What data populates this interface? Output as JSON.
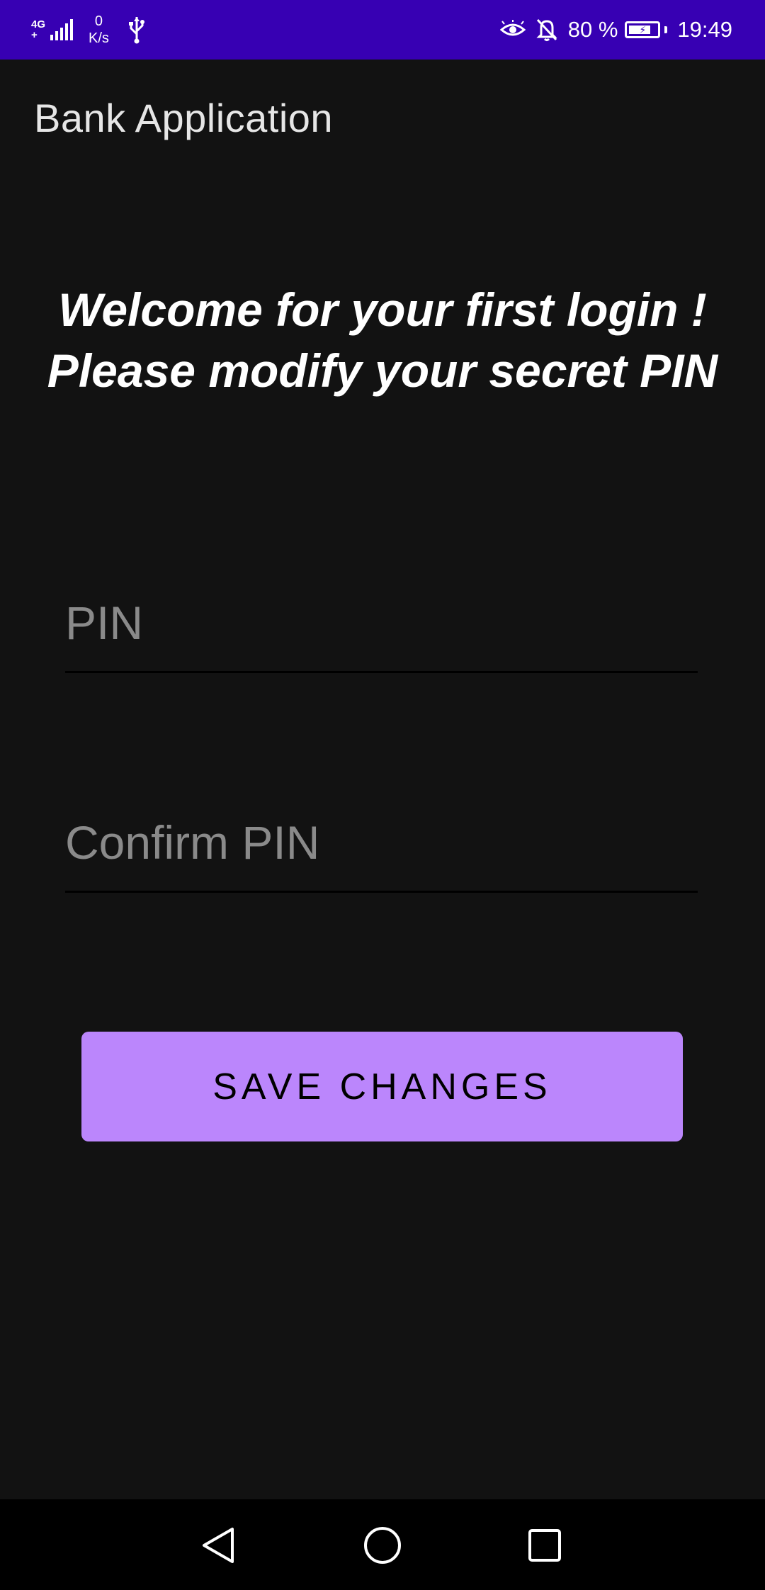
{
  "status_bar": {
    "network_type": "4G",
    "network_sub": "+",
    "speed_value": "0",
    "speed_unit": "K/s",
    "battery_percent": "80 %",
    "time": "19:49",
    "icons": [
      "signal-icon",
      "usb-icon",
      "eye-comfort-icon",
      "bell-muted-icon",
      "battery-charging-icon"
    ],
    "battery_level": 0.8,
    "background_color": "#3700b3"
  },
  "app_bar": {
    "title": "Bank Application"
  },
  "welcome": {
    "line1": "Welcome for your first login !",
    "line2": "Please modify your secret PIN"
  },
  "form": {
    "pin_placeholder": "PIN",
    "pin_value": "",
    "confirm_placeholder": "Confirm PIN",
    "confirm_value": ""
  },
  "actions": {
    "save_label": "SAVE CHANGES",
    "accent_color": "#bb86fc"
  },
  "nav_bar": {
    "icons": [
      "back-icon",
      "home-icon",
      "recent-apps-icon"
    ]
  }
}
